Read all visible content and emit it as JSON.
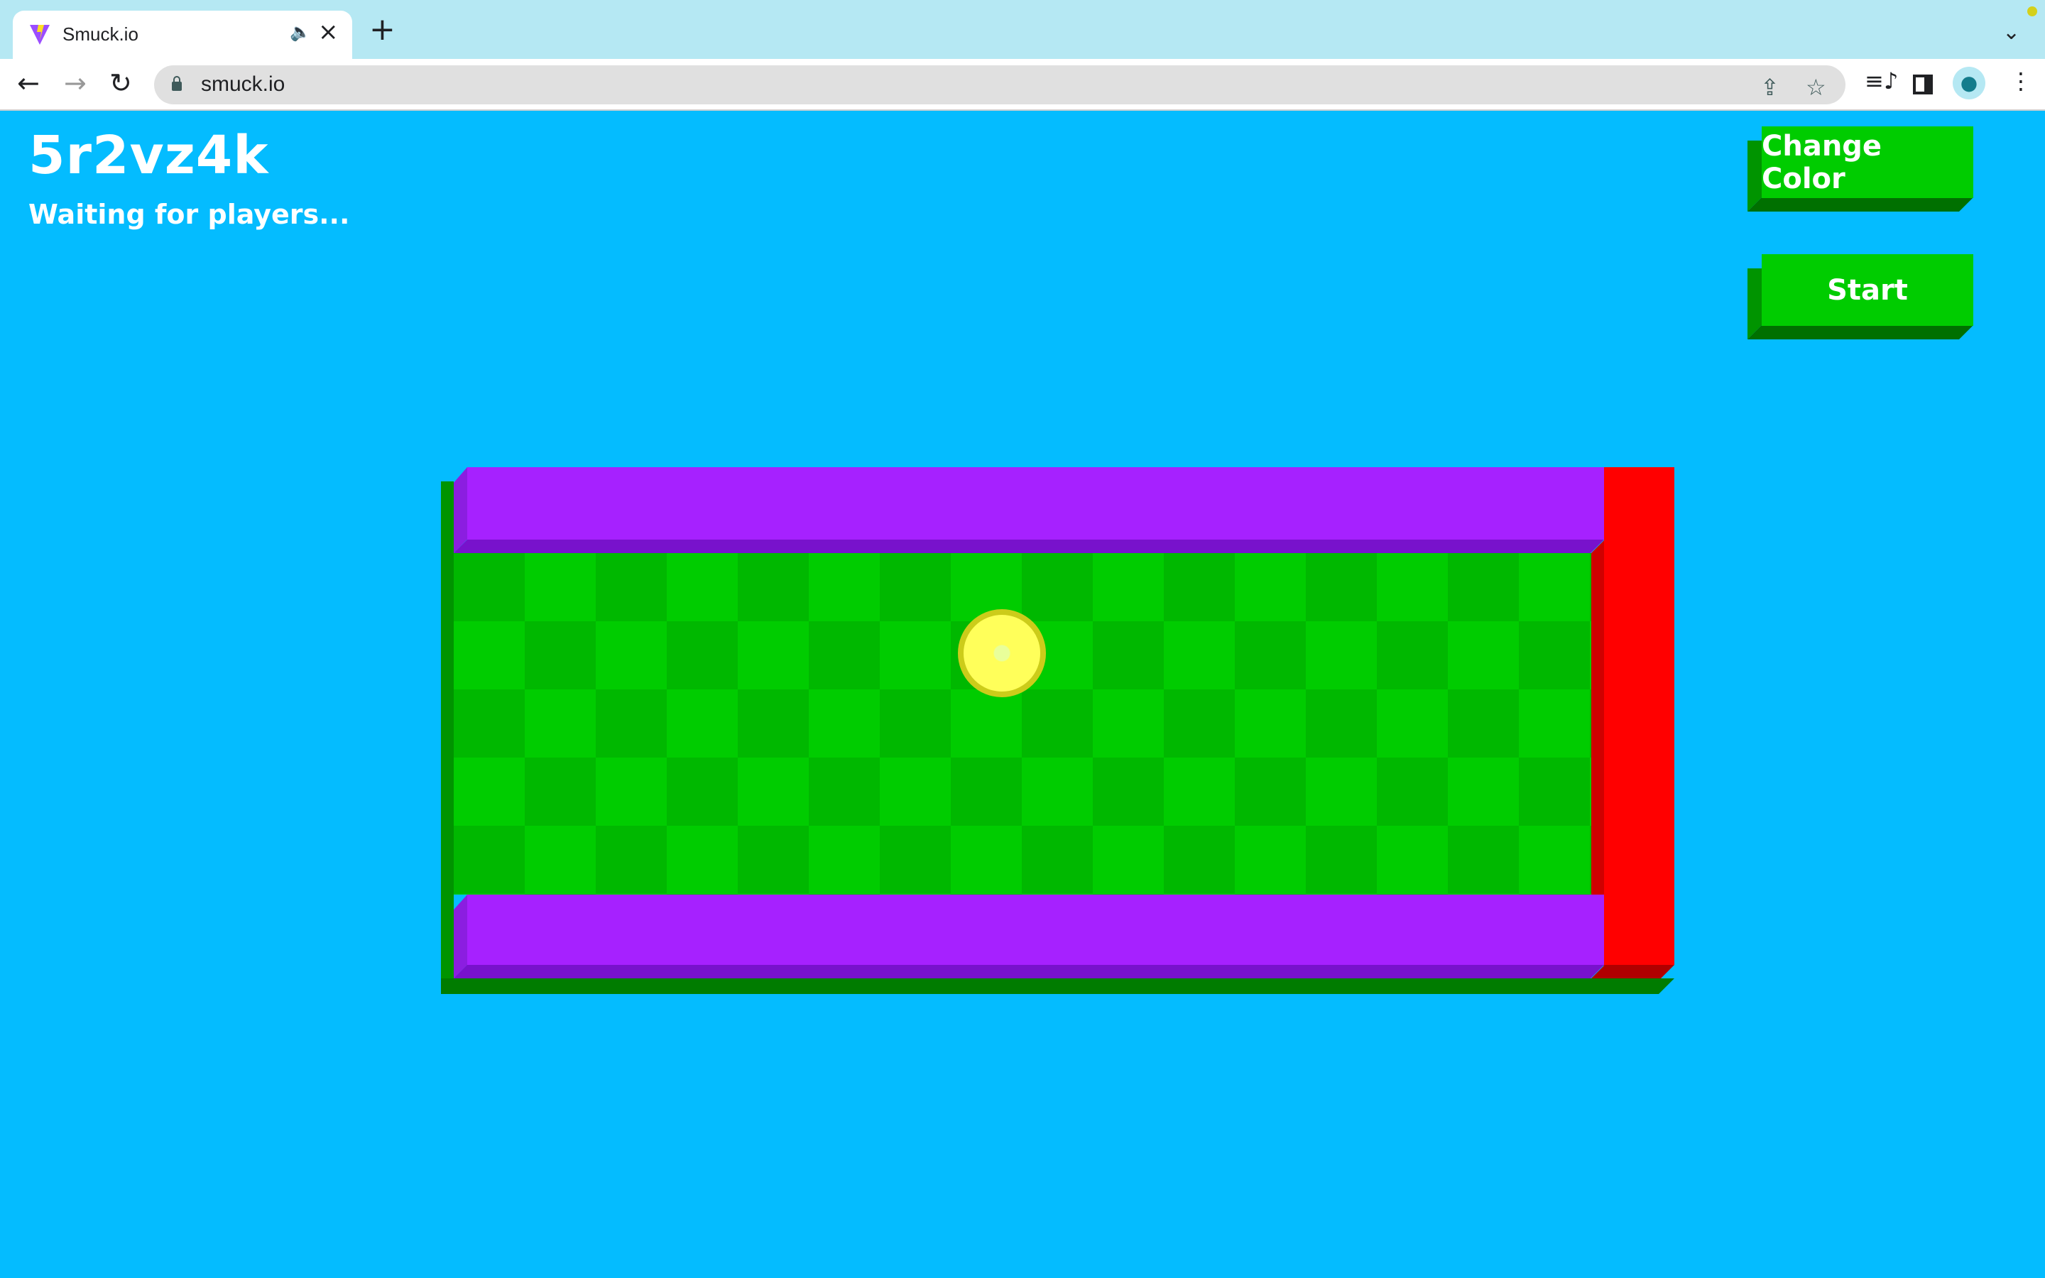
{
  "browser": {
    "tab_title": "Smuck.io",
    "url": "smuck.io",
    "icons": [
      "vite-favicon",
      "speaker-icon",
      "close-icon",
      "plus-icon",
      "back-icon",
      "forward-icon",
      "reload-icon",
      "lock-icon",
      "share-icon",
      "star-icon",
      "media-icon",
      "sidepanel-icon",
      "profile-icon",
      "menu-icon",
      "chevron-down-icon"
    ]
  },
  "game": {
    "room_code": "5r2vz4k",
    "status": "Waiting for players...",
    "buttons": {
      "change_color": "Change Color",
      "start": "Start"
    },
    "colors": {
      "background": "#04bcff",
      "button": "#00cc00",
      "wall": "#a621ff",
      "goal_wall": "#ff0000",
      "floor_light": "#00cc00",
      "floor_dark": "#00b800",
      "ball": "#ffff5a"
    },
    "grid": {
      "columns": 16,
      "rows": 5
    }
  }
}
